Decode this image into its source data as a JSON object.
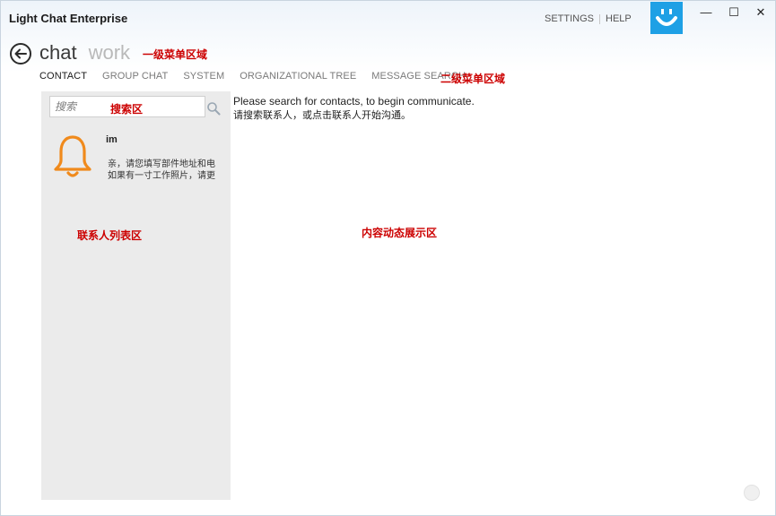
{
  "app": {
    "title": "Light Chat Enterprise"
  },
  "top_links": {
    "settings": "SETTINGS",
    "help": "HELP"
  },
  "window_controls": {
    "minimize": "—",
    "maximize": "☐",
    "close": "✕"
  },
  "primary_menu": {
    "items": [
      {
        "label": "chat"
      },
      {
        "label": "work"
      }
    ]
  },
  "secondary_menu": {
    "tabs": [
      {
        "label": "CONTACT"
      },
      {
        "label": "GROUP CHAT"
      },
      {
        "label": "SYSTEM"
      },
      {
        "label": "ORGANIZATIONAL TREE"
      },
      {
        "label": "MESSAGE SEARCH"
      }
    ]
  },
  "annotations": {
    "primary_menu_area": "一级菜单区域",
    "secondary_menu_area": "二级菜单区域",
    "search_area": "搜索区",
    "contact_list_area": "联系人列表区",
    "content_area": "内容动态展示区"
  },
  "search": {
    "placeholder": "搜索"
  },
  "contacts": [
    {
      "name": "im",
      "message_line1": "亲，请您填写部件地址和电",
      "message_line2": "如果有一寸工作照片，请更"
    }
  ],
  "content": {
    "line1": "Please search for contacts, to begin communicate.",
    "line2": "请搜索联系人，或点击联系人开始沟通。"
  },
  "colors": {
    "accent": "#1ea0e5",
    "annotation": "#cc0000",
    "bell": "#f08a1c",
    "panel": "#ebebeb"
  }
}
